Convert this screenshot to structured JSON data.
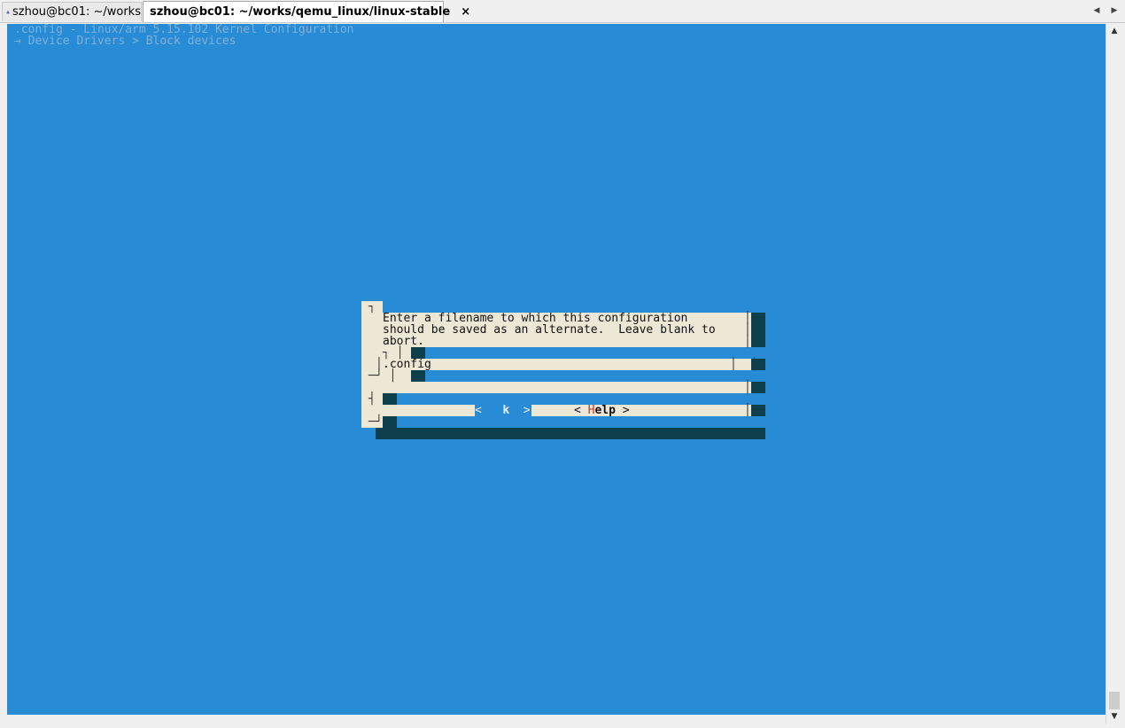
{
  "tabs": [
    {
      "label": "szhou@bc01: ~/works",
      "status_icon": "warning-icon",
      "active": false
    },
    {
      "label": "szhou@bc01: ~/works/qemu_linux/linux-stable",
      "status_icon": "check-icon",
      "active": true,
      "close": "×"
    }
  ],
  "terminal": {
    "header_line1": ".config - Linux/arm 5.15.102 Kernel Configuration",
    "header_line2": "→ Device Drivers > Block devices",
    "colors": {
      "background": "#288bd5",
      "dialog": "#ede7d5",
      "shadow": "#0e3f4d",
      "hotkey": "#d03030"
    }
  },
  "dialog": {
    "message_lines": [
      "Enter a filename to which this configuration",
      "should be saved as an alternate.  Leave blank to",
      "abort."
    ],
    "input_value": ".config",
    "buttons": {
      "ok": {
        "left": "<",
        "hotkey": " ",
        "rest": "k",
        "right": ">"
      },
      "help": {
        "left": "<",
        "hotkey": "H",
        "rest": "elp",
        "right": ">"
      }
    }
  }
}
